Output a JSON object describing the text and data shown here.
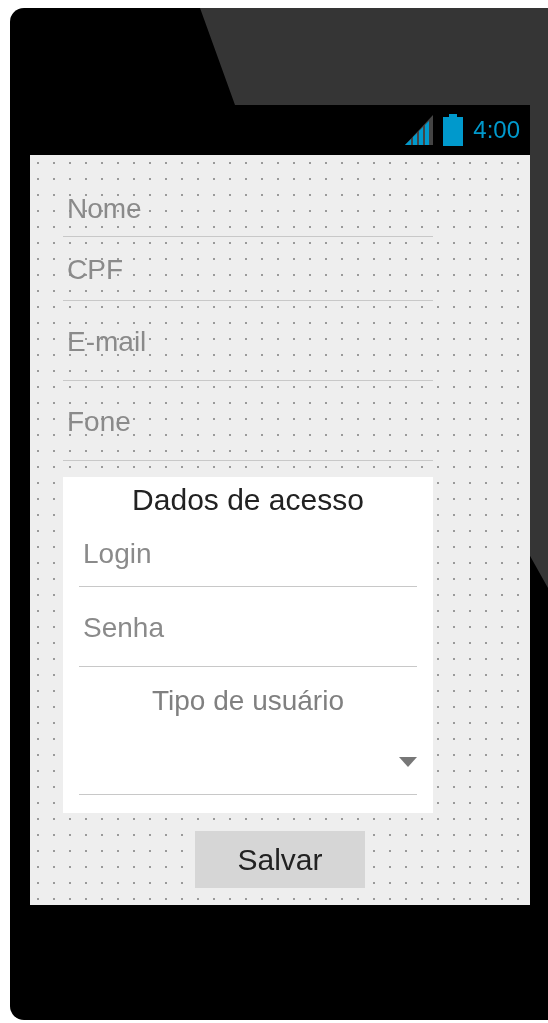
{
  "status_bar": {
    "time": "4:00"
  },
  "fields": [
    {
      "placeholder": "Nome"
    },
    {
      "placeholder": "CPF"
    },
    {
      "placeholder": "E-mail"
    },
    {
      "placeholder": "Fone"
    }
  ],
  "access_section": {
    "title": "Dados de acesso",
    "fields": [
      {
        "placeholder": "Login"
      },
      {
        "placeholder": "Senha"
      }
    ],
    "user_type_label": "Tipo de usuário"
  },
  "save_button": "Salvar"
}
